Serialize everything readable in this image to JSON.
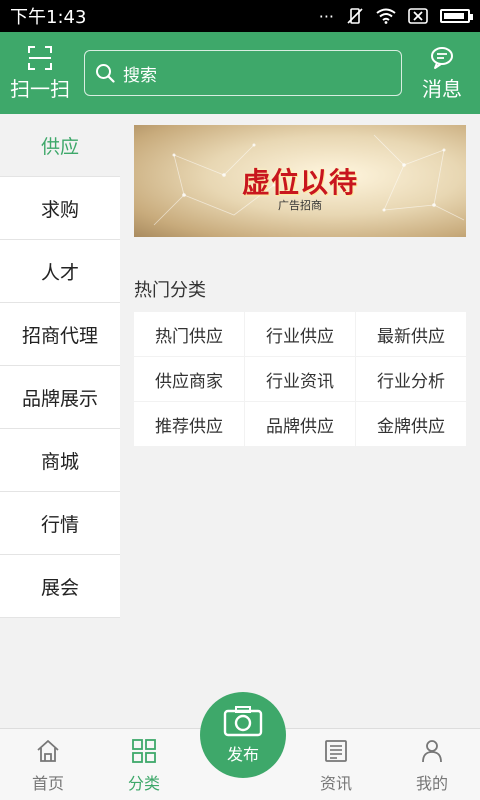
{
  "status": {
    "time": "下午1:43"
  },
  "header": {
    "scan_label": "扫一扫",
    "search_placeholder": "搜索",
    "message_label": "消息"
  },
  "sidebar": {
    "items": [
      {
        "label": "供应",
        "active": true
      },
      {
        "label": "求购"
      },
      {
        "label": "人才"
      },
      {
        "label": "招商代理"
      },
      {
        "label": "品牌展示"
      },
      {
        "label": "商城"
      },
      {
        "label": "行情"
      },
      {
        "label": "展会"
      }
    ]
  },
  "banner": {
    "title": "虚位以待",
    "subtitle": "广告招商"
  },
  "hot": {
    "title": "热门分类",
    "items": [
      "热门供应",
      "行业供应",
      "最新供应",
      "供应商家",
      "行业资讯",
      "行业分析",
      "推荐供应",
      "品牌供应",
      "金牌供应"
    ]
  },
  "bottomnav": {
    "home": "首页",
    "category": "分类",
    "publish": "发布",
    "news": "资讯",
    "mine": "我的"
  },
  "colors": {
    "brand": "#3ea86a"
  }
}
